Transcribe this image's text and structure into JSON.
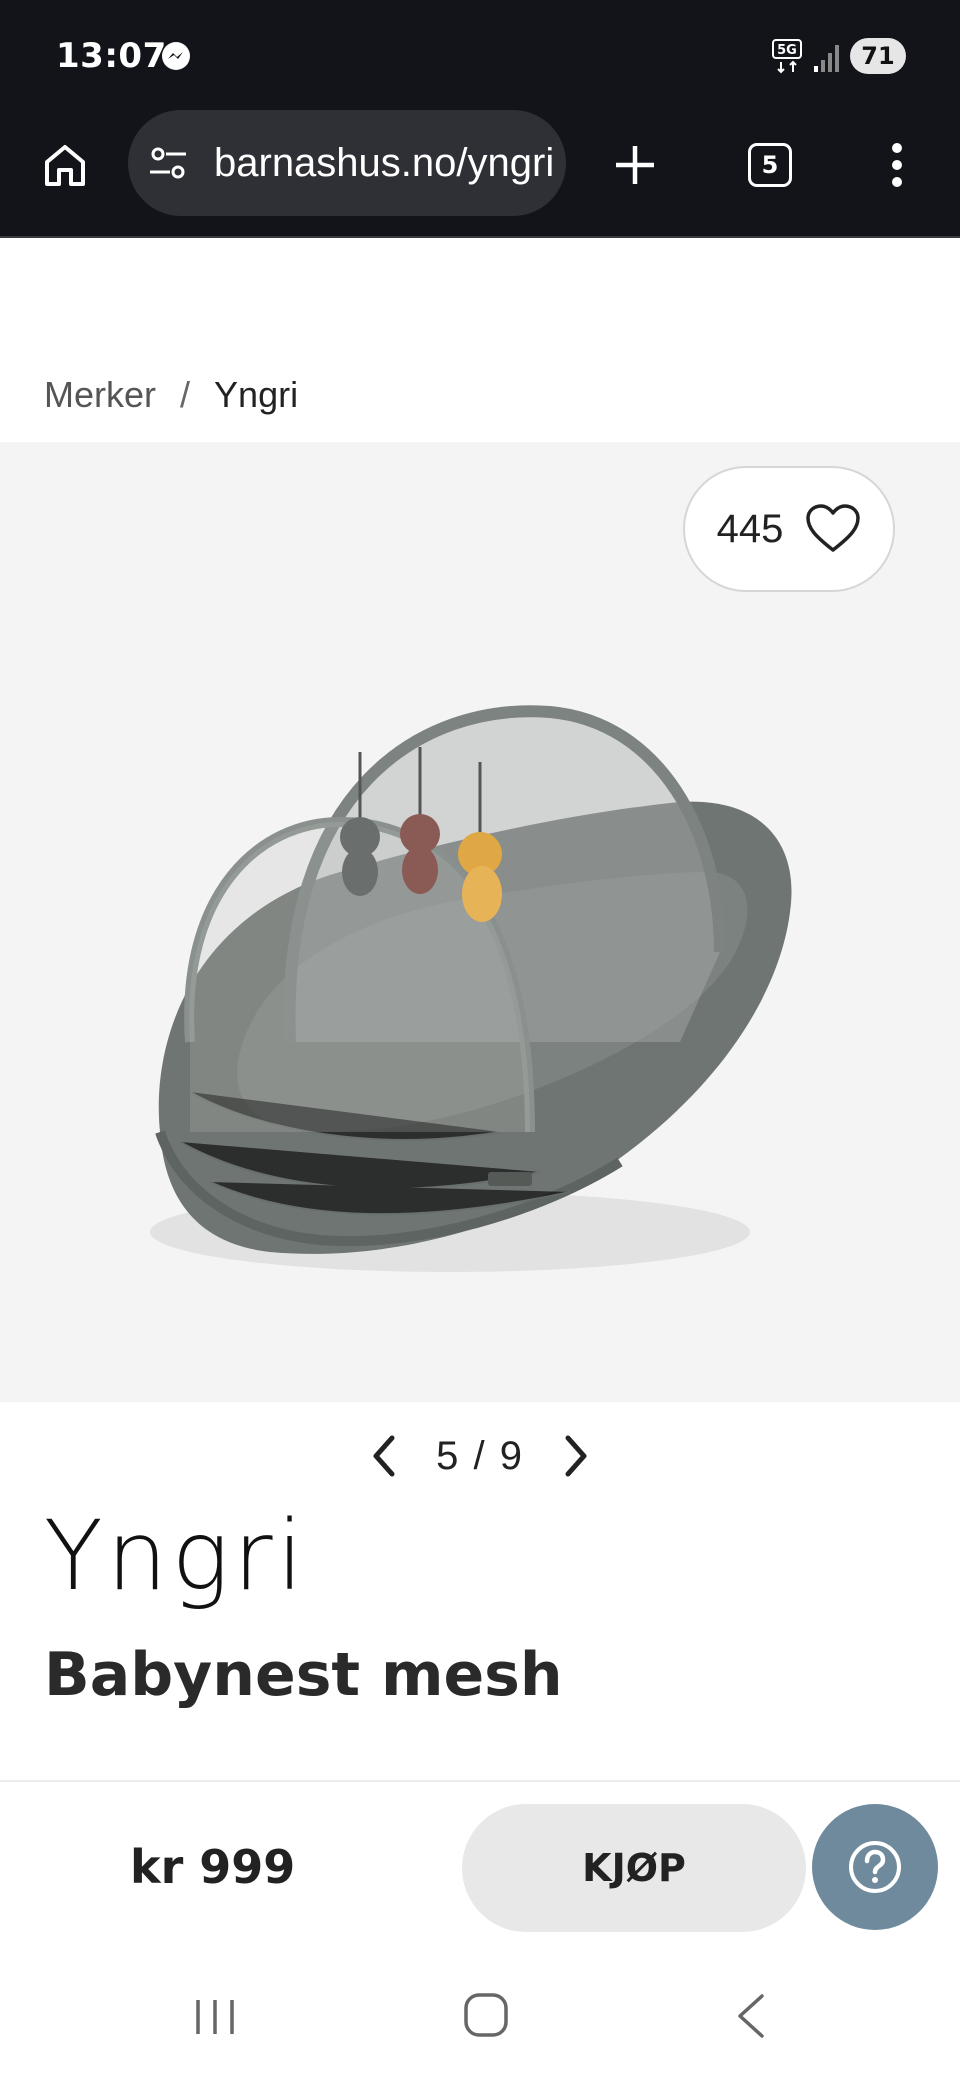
{
  "status_bar": {
    "time": "13:07",
    "battery": "71",
    "icons": [
      "messenger-icon",
      "5g-icon",
      "signal-icon"
    ]
  },
  "browser": {
    "url": "barnashus.no/yngri",
    "tab_count": "5",
    "icons": [
      "home-icon",
      "site-settings-icon",
      "new-tab-icon",
      "tabs-icon",
      "more-vert-icon"
    ]
  },
  "breadcrumb": {
    "items": [
      "Merker",
      "Yngri"
    ],
    "separator": "/"
  },
  "gallery": {
    "favorite_count": "445",
    "current": "5",
    "separator": "/",
    "total": "9",
    "colors": {
      "background": "#f4f4f4",
      "nest": "#6f7572"
    }
  },
  "product": {
    "brand": "Yngri",
    "title": "Babynest mesh"
  },
  "purchase": {
    "price": "kr 999",
    "buy_label": "KJØP",
    "help_color": "#6e8a9c"
  },
  "navigation": {
    "icons": [
      "recent-apps-icon",
      "home-button-icon",
      "back-icon"
    ]
  }
}
